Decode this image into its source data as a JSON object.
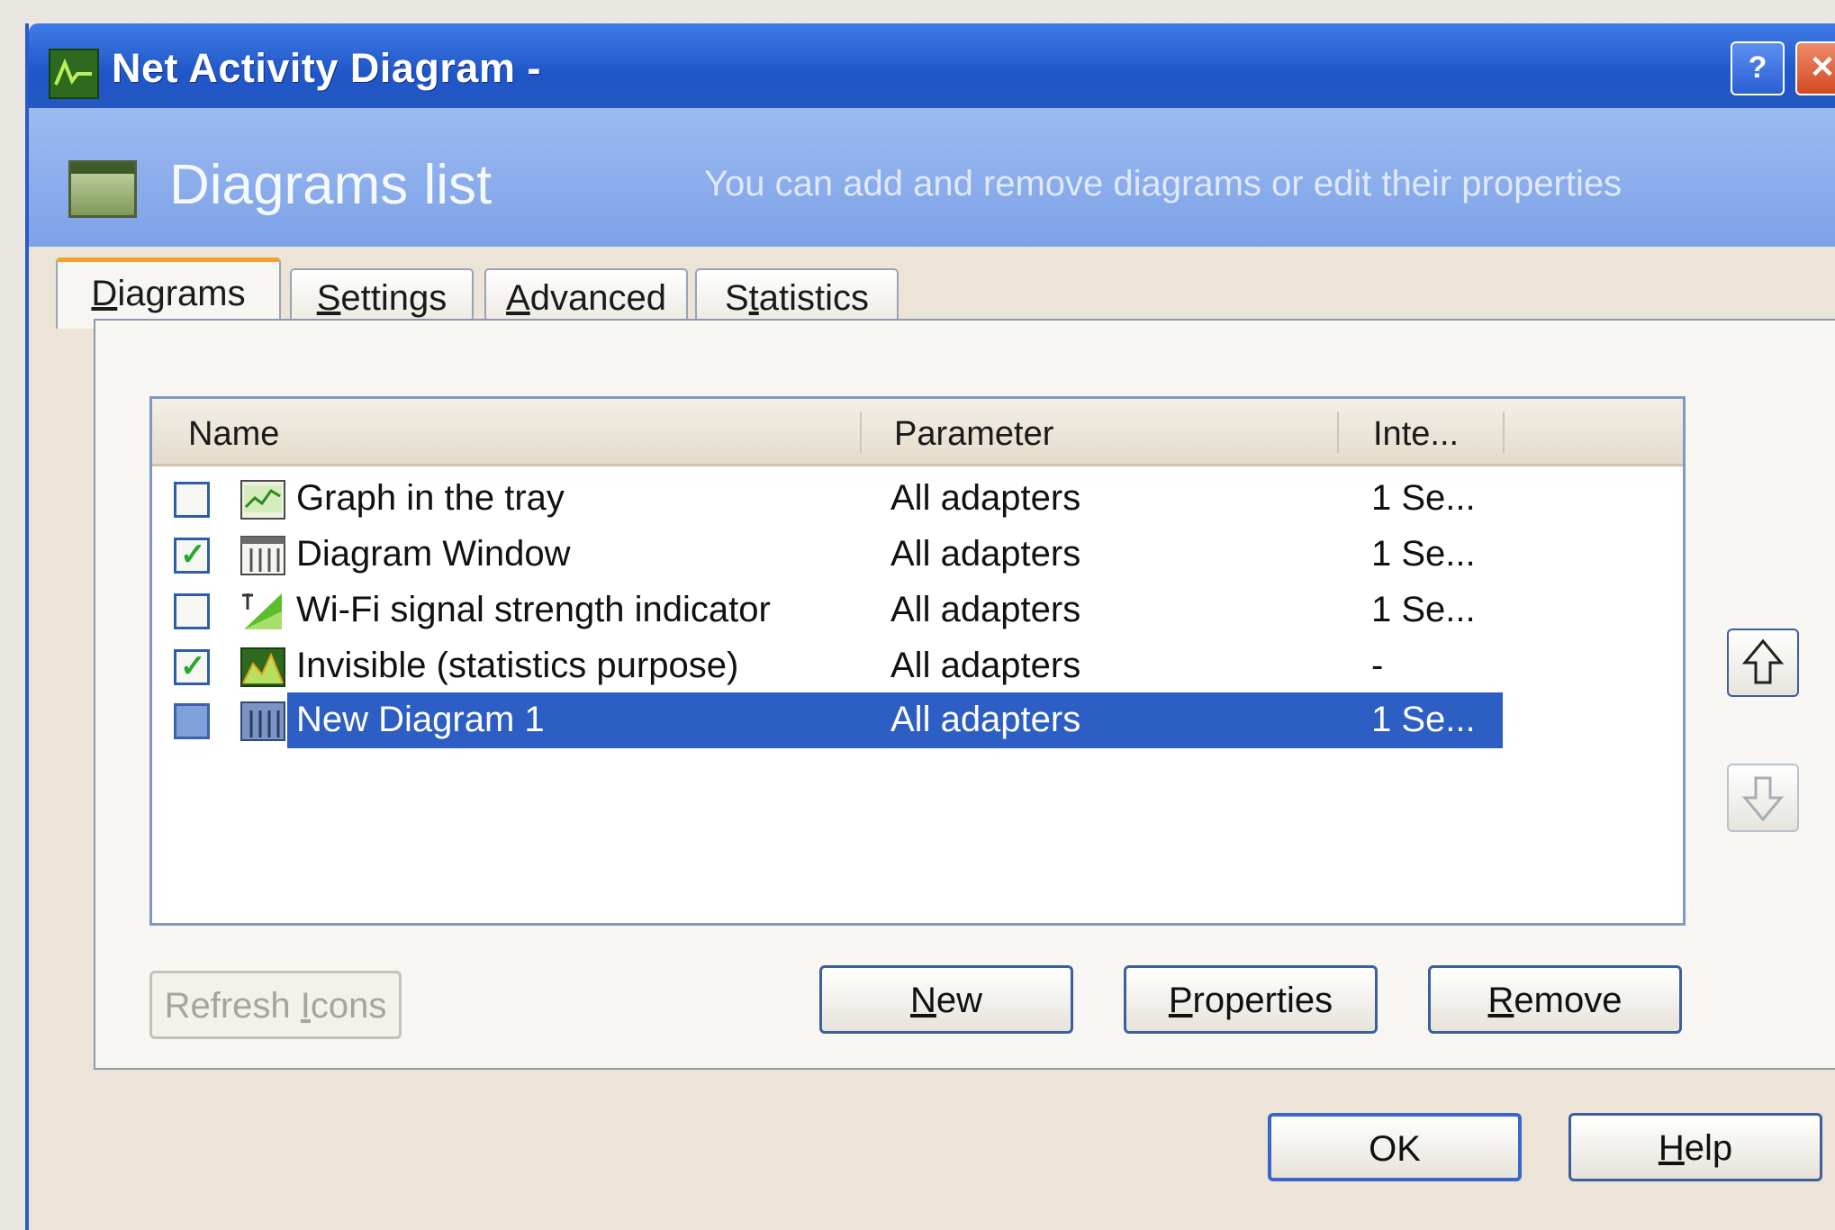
{
  "window": {
    "title": "Net Activity Diagram -",
    "help_button": "?",
    "close_button": "✕"
  },
  "header": {
    "title": "Diagrams list",
    "description": "You can add and remove diagrams or edit their properties"
  },
  "tabs": [
    {
      "label": "Diagrams",
      "active": true
    },
    {
      "label": "Settings",
      "active": false
    },
    {
      "label": "Advanced",
      "active": false
    },
    {
      "label": "Statistics",
      "active": false
    }
  ],
  "list": {
    "columns": [
      "Name",
      "Parameter",
      "Inte..."
    ],
    "rows": [
      {
        "checked": false,
        "icon": "tray-graph-icon",
        "name": "Graph in the tray",
        "parameter": "All adapters",
        "interval": "1 Se...",
        "selected": false
      },
      {
        "checked": true,
        "icon": "diagram-window-icon",
        "name": "Diagram Window",
        "parameter": "All adapters",
        "interval": "1 Se...",
        "selected": false
      },
      {
        "checked": false,
        "icon": "wifi-signal-icon",
        "name": "Wi-Fi signal strength indicator",
        "parameter": "All adapters",
        "interval": "1 Se...",
        "selected": false
      },
      {
        "checked": true,
        "icon": "statistics-chart-icon",
        "name": "Invisible (statistics purpose)",
        "parameter": "All adapters",
        "interval": "-",
        "selected": false
      },
      {
        "checked": false,
        "icon": "new-diagram-icon",
        "name": "New Diagram 1",
        "parameter": "All adapters",
        "interval": "1 Se...",
        "selected": true
      }
    ]
  },
  "buttons": {
    "refresh_icons": {
      "pre": "Refresh ",
      "key": "I",
      "post": "cons"
    },
    "new": {
      "pre": "",
      "key": "N",
      "post": "ew"
    },
    "properties": {
      "pre": "",
      "key": "P",
      "post": "roperties"
    },
    "remove": {
      "pre": "",
      "key": "R",
      "post": "emove"
    },
    "ok": "OK",
    "help": {
      "pre": "",
      "key": "H",
      "post": "elp"
    }
  },
  "tab_labels": {
    "diagrams": {
      "key": "D",
      "post": "iagrams"
    },
    "settings": {
      "key": "S",
      "post": "ettings"
    },
    "advanced": {
      "key": "A",
      "post": "dvanced"
    },
    "statistics": {
      "pre": "S",
      "key": "t",
      "post": "atistics"
    }
  },
  "colors": {
    "titlebar": "#1f56c8",
    "selection": "#2c5ec4",
    "check": "#25a82c",
    "active_tab_accent": "#f3a12a"
  }
}
